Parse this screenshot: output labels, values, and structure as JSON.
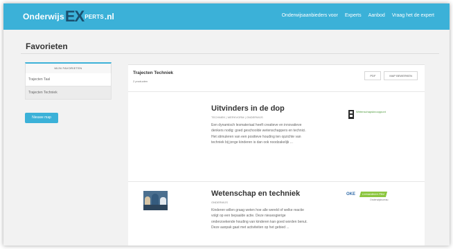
{
  "header": {
    "logo": {
      "part1": "Onderwijs",
      "part2": "EX",
      "part3": "PERTS",
      "part4": ".nl"
    },
    "nav": [
      "Onderwijsaanbieders voor",
      "Experts",
      "Aanbod",
      "Vraag het de expert"
    ]
  },
  "page": {
    "title": "Favorieten"
  },
  "sidebar": {
    "header": "MIJN FAVORIETEN",
    "items": [
      "Trajecten Taal",
      "Trajecten Techniek"
    ],
    "new_button": "Nieuwe map"
  },
  "main": {
    "title": "Trajecten Techniek",
    "subtitle": "2 producten",
    "buttons": [
      "PDF",
      "MAP BEWERKEN"
    ],
    "items": [
      {
        "title": "Uitvinders in de dop",
        "meta": "TECHNIEK | WERKVORM | ONDERWIJS",
        "description": "Een dynamisch lesmateriaal heeft creatieve en innovatieve denkers nodig: goed geschoolde wetenschappers en technici. Het stimuleren van een positieve houding ten opzichte van techniek bij jonge kinderen is dan ook noodzakelijk ...",
        "partner": "Wetenschapsknooppunt"
      },
      {
        "title": "Wetenschap en techniek",
        "meta": "ONDERWIJS",
        "description": "Kinderen willen graag weten hoe alle wereld of welke reactie volgt op een bepaalde actie. Deze nieuwsgierige onderzoekende houding van kinderen kan goed worden benut. Deze aanpak gaat met activiteiten op het gebied ...",
        "partner": {
          "name1": "OKE",
          "name2": "Leeranderen Pilot",
          "name3": "Onderwijsbureau"
        }
      }
    ]
  },
  "colors": {
    "accent": "#3bb1d8",
    "background": "#f2f2f2"
  }
}
